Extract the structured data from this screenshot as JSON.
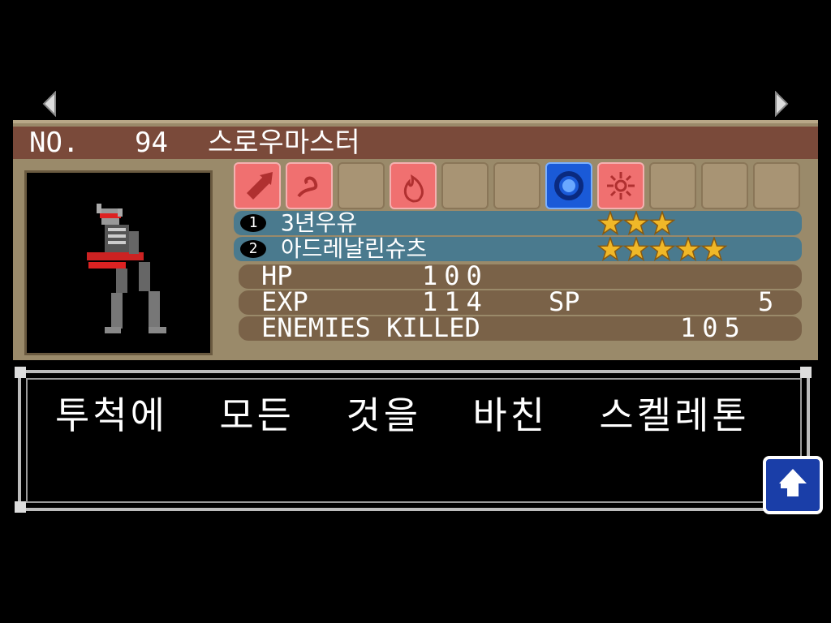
{
  "nav": {
    "prev_icon": "triangle-left-icon",
    "next_icon": "triangle-right-icon"
  },
  "enemy": {
    "no_label": "NO.",
    "number": "94",
    "name": "스로우마스터"
  },
  "soul_slots": [
    {
      "state": "red",
      "icon": "axe-icon"
    },
    {
      "state": "red",
      "icon": "whip-icon"
    },
    {
      "state": "empty",
      "icon": ""
    },
    {
      "state": "red",
      "icon": "fire-icon"
    },
    {
      "state": "empty",
      "icon": ""
    },
    {
      "state": "empty",
      "icon": ""
    },
    {
      "state": "blue",
      "icon": "ring-icon"
    },
    {
      "state": "red",
      "icon": "burst-icon"
    },
    {
      "state": "empty",
      "icon": ""
    },
    {
      "state": "empty",
      "icon": ""
    },
    {
      "state": "empty",
      "icon": ""
    }
  ],
  "drops": [
    {
      "num": "1",
      "name": "3년우유",
      "stars": 3
    },
    {
      "num": "2",
      "name": "아드레날린슈츠",
      "stars": 5
    }
  ],
  "stats": {
    "hp_label": "HP",
    "hp_value": "100",
    "exp_label": "EXP",
    "exp_value": "114",
    "sp_label": "SP",
    "sp_value": "5",
    "killed_label": "ENEMIES KILLED",
    "killed_value": "105"
  },
  "description": "투척에  모든  것을  바친  스켈레톤",
  "colors": {
    "panel": "#9a8a6a",
    "title_bar": "#7a4a3a",
    "soul_row": "#4a7a8e",
    "stat_row": "#7a6248",
    "star": "#f0b828"
  }
}
